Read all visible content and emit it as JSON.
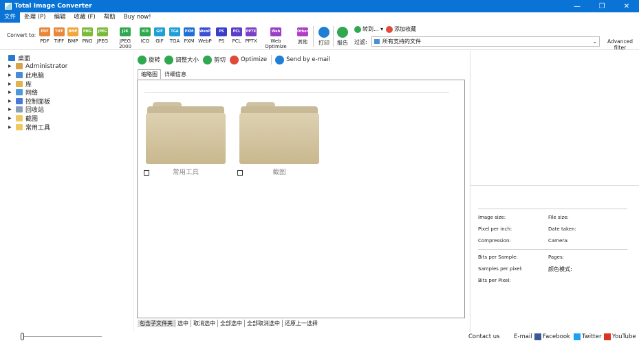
{
  "window": {
    "title": "Total Image Converter",
    "controls": [
      "—",
      "❐",
      "✕"
    ]
  },
  "menu": [
    "文件",
    "处理 (P)",
    "编辑",
    "收藏 (F)",
    "帮助",
    "Buy now!"
  ],
  "toolbar": {
    "convert_label": "Convert to:",
    "formats": [
      {
        "label": "PDF",
        "icon": "PDF",
        "color": "#e8863a"
      },
      {
        "label": "TIFF",
        "icon": "TIFF",
        "color": "#e8863a"
      },
      {
        "label": "BMP",
        "icon": "BMP",
        "color": "#f0a63a"
      },
      {
        "label": "PNG",
        "icon": "PNG",
        "color": "#7ab93a"
      },
      {
        "label": "JPEG",
        "icon": "JPEG",
        "color": "#7ab93a"
      },
      {
        "label": "JPEG 2000",
        "icon": "J2K",
        "color": "#2fa84f"
      },
      {
        "label": "ICO",
        "icon": "ICO",
        "color": "#2fa84f"
      },
      {
        "label": "GIF",
        "icon": "GIF",
        "color": "#1f9fd6"
      },
      {
        "label": "TGA",
        "icon": "TGA",
        "color": "#1f9fd6"
      },
      {
        "label": "PXM",
        "icon": "PXM",
        "color": "#1f6fd6"
      },
      {
        "label": "WebP",
        "icon": "WebP",
        "color": "#3a4fd6"
      },
      {
        "label": "PS",
        "icon": "PS",
        "color": "#3a3fc6"
      },
      {
        "label": "PCL",
        "icon": "PCL",
        "color": "#5a3fc6"
      },
      {
        "label": "PPTX",
        "icon": "PPTX",
        "color": "#7a3fc6"
      },
      {
        "label": "Web Optimize",
        "icon": "Web",
        "color": "#9a3fc6"
      },
      {
        "label": "其他",
        "icon": "Other",
        "color": "#b03fc6"
      }
    ],
    "print_label": "打印",
    "report_label": "报告",
    "goto_label": "转到...",
    "favorite_label": "添加收藏",
    "filter_label": "过滤:",
    "filter_value": "所有支持的文件",
    "advanced_filter": "Advanced filter"
  },
  "tree": [
    {
      "label": "桌面",
      "root": true,
      "color": "#2a78c8"
    },
    {
      "label": "Administrator",
      "color": "#d9a24a"
    },
    {
      "label": "此电脑",
      "color": "#4a8ad9"
    },
    {
      "label": "库",
      "color": "#e0b44a"
    },
    {
      "label": "网络",
      "color": "#4a9ad9"
    },
    {
      "label": "控制面板",
      "color": "#4a7ad9"
    },
    {
      "label": "回收站",
      "color": "#8aa0b8"
    },
    {
      "label": "截图",
      "color": "#f0c860"
    },
    {
      "label": "常用工具",
      "color": "#f0c860"
    }
  ],
  "actions": [
    {
      "label": "旋转",
      "color": "#2fa84f"
    },
    {
      "label": "调整大小",
      "color": "#2fa84f"
    },
    {
      "label": "剪切",
      "color": "#2fa84f"
    },
    {
      "label": "Optimize",
      "color": "#e04a3a"
    },
    {
      "label": "Send by e-mail",
      "color": "#1f7fd6"
    }
  ],
  "tabs": [
    "缩略图",
    "详细信息"
  ],
  "folders": [
    {
      "label": "常用工具"
    },
    {
      "label": "截图"
    }
  ],
  "bottom_actions": [
    "包含子文件夹",
    "选中",
    "取消选中",
    "全部选中",
    "全部取消选中",
    "还原上一选择"
  ],
  "info": {
    "image_size": "Image size:",
    "file_size": "File size:",
    "ppi": "Pixel per inch:",
    "date_taken": "Date taken:",
    "compression": "Compression:",
    "camera": "Camera:",
    "bits_per_sample": "Bits per Sample:",
    "pages": "Pages:",
    "samples_per_pixel": "Samples per pixel:",
    "color_mode": "颜色模式:",
    "bits_per_pixel": "Bits per Pixel:"
  },
  "footer": {
    "contact": "Contact us",
    "email": "E-mail",
    "facebook": "Facebook",
    "twitter": "Twitter",
    "youtube": "YouTube"
  }
}
